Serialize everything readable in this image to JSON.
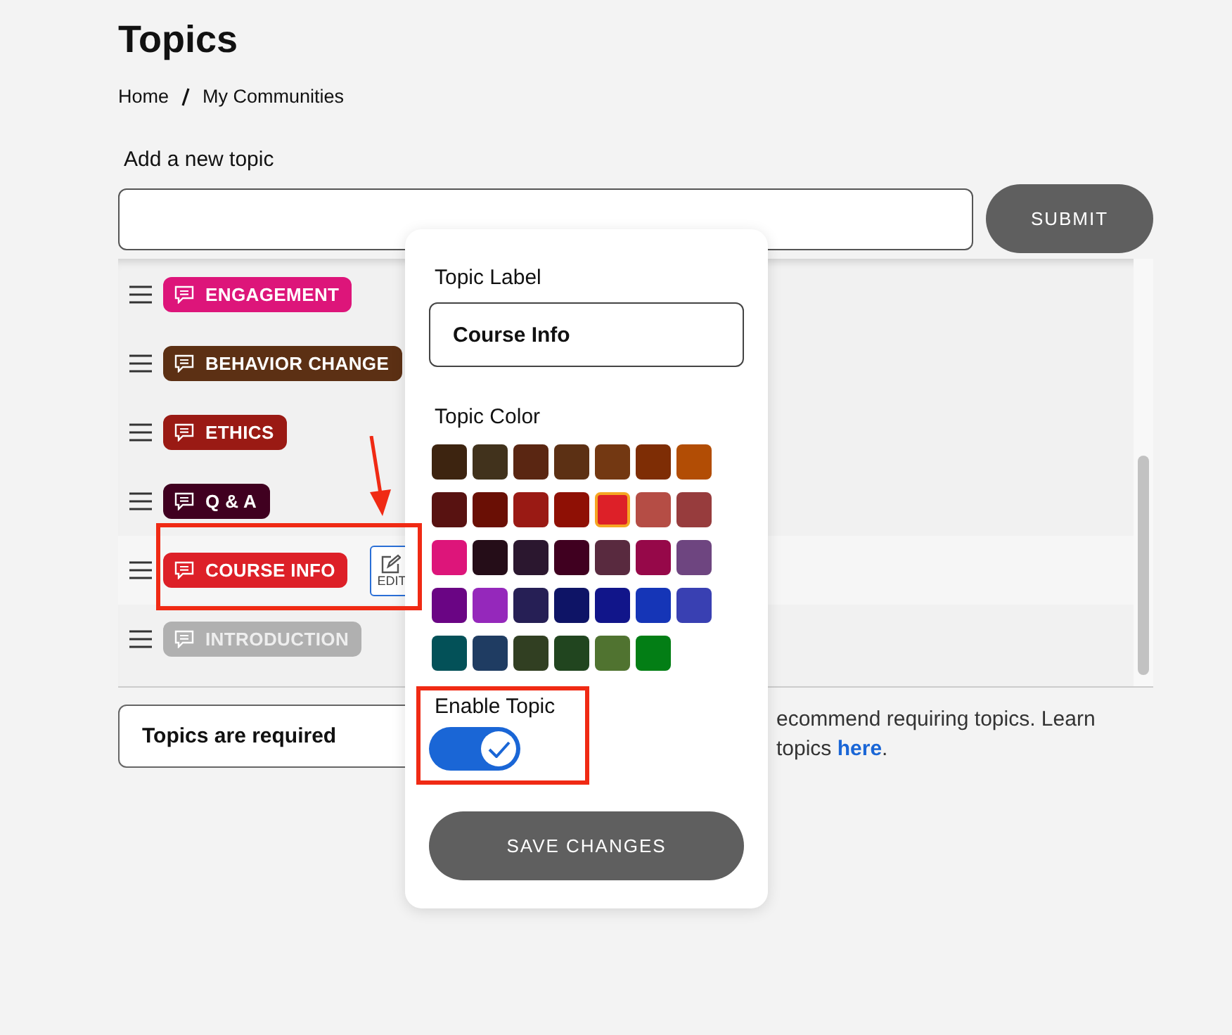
{
  "page_title": "Topics",
  "breadcrumb": [
    "Home",
    "My Communities"
  ],
  "new_topic": {
    "label": "Add a new topic",
    "button": "SUBMIT"
  },
  "topics": [
    {
      "name": "ENGAGEMENT",
      "color": "#dd157a",
      "enabled": true,
      "selected": false
    },
    {
      "name": "BEHAVIOR CHANGE",
      "color": "#5c3014",
      "enabled": true,
      "selected": false
    },
    {
      "name": "ETHICS",
      "color": "#9a1a14",
      "enabled": true,
      "selected": false
    },
    {
      "name": "Q & A",
      "color": "#400020",
      "enabled": true,
      "selected": false
    },
    {
      "name": "COURSE INFO",
      "color": "#dd2028",
      "enabled": true,
      "selected": true
    },
    {
      "name": "INTRODUCTION",
      "color": "#b0b0b0",
      "enabled": false,
      "selected": false
    }
  ],
  "edit_button": "EDIT",
  "required": {
    "label": "Topics are required",
    "note_line_1": "ecommend requiring topics. Learn",
    "note_line_2": "topics ",
    "link": "here",
    "note_end": "."
  },
  "popover": {
    "label_title": "Topic Label",
    "label_value": "Course Info",
    "color_title": "Topic Color",
    "swatches": [
      {
        "color": "#3d2410",
        "selected": false
      },
      {
        "color": "#41321c",
        "selected": false
      },
      {
        "color": "#5a2612",
        "selected": false
      },
      {
        "color": "#5c3014",
        "selected": false
      },
      {
        "color": "#733812",
        "selected": false
      },
      {
        "color": "#7e2d05",
        "selected": false
      },
      {
        "color": "#b24d05",
        "selected": false
      },
      {
        "color": "#581211",
        "selected": false
      },
      {
        "color": "#6a0f05",
        "selected": false
      },
      {
        "color": "#9a1a14",
        "selected": false
      },
      {
        "color": "#8f1005",
        "selected": false
      },
      {
        "color": "#dd2028",
        "selected": true
      },
      {
        "color": "#b54d45",
        "selected": false
      },
      {
        "color": "#973c3d",
        "selected": false
      },
      {
        "color": "#dd157a",
        "selected": false
      },
      {
        "color": "#250d18",
        "selected": false
      },
      {
        "color": "#2b172f",
        "selected": false
      },
      {
        "color": "#400020",
        "selected": false
      },
      {
        "color": "#592a3f",
        "selected": false
      },
      {
        "color": "#960849",
        "selected": false
      },
      {
        "color": "#6e4580",
        "selected": false
      },
      {
        "color": "#6a0584",
        "selected": false
      },
      {
        "color": "#9528bb",
        "selected": false
      },
      {
        "color": "#261f55",
        "selected": false
      },
      {
        "color": "#0e1466",
        "selected": false
      },
      {
        "color": "#11158a",
        "selected": false
      },
      {
        "color": "#1535b7",
        "selected": false
      },
      {
        "color": "#3940b2",
        "selected": false
      },
      {
        "color": "#035158",
        "selected": false
      },
      {
        "color": "#1f3c62",
        "selected": false
      },
      {
        "color": "#313f22",
        "selected": false
      },
      {
        "color": "#21451f",
        "selected": false
      },
      {
        "color": "#507330",
        "selected": false
      },
      {
        "color": "#037e15",
        "selected": false
      }
    ],
    "enable_label": "Enable Topic",
    "enabled": true,
    "save_button": "SAVE CHANGES"
  }
}
